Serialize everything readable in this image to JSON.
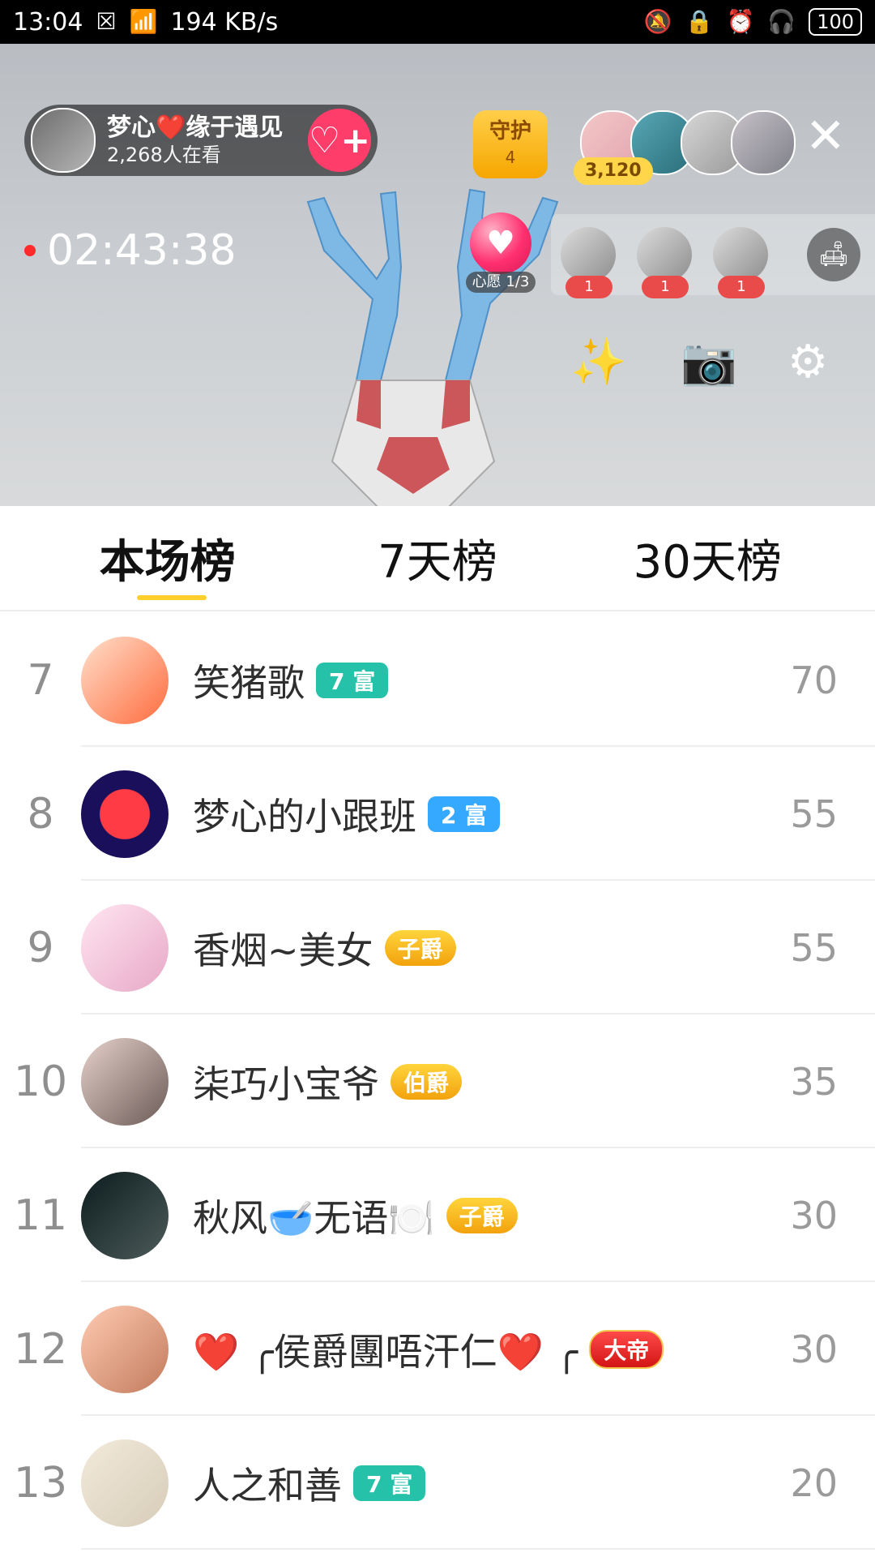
{
  "status_bar": {
    "time": "13:04",
    "network_speed": "194 KB/s",
    "battery": "100"
  },
  "live": {
    "host_name": "梦心❤️缘于遇见",
    "viewers": "2,268人在看",
    "follow_button": "♡+",
    "guard_label": "守护",
    "guard_count": "4",
    "contribution": "3,120",
    "timer": "02:43:38",
    "wish_label": "心愿 1/3",
    "mic_counts": [
      "1",
      "1",
      "1"
    ]
  },
  "tabs": [
    {
      "label": "本场榜"
    },
    {
      "label": "7天榜"
    },
    {
      "label": "30天榜"
    }
  ],
  "rank_rows": [
    {
      "rank": "7",
      "name": "笑猪歌",
      "badge": "7 富",
      "score": "70"
    },
    {
      "rank": "8",
      "name": "梦心的小跟班",
      "badge": "2 富",
      "score": "55"
    },
    {
      "rank": "9",
      "name": "香烟~美女",
      "badge": "子爵",
      "score": "55"
    },
    {
      "rank": "10",
      "name": "柒巧小宝爷",
      "badge": "伯爵",
      "score": "35"
    },
    {
      "rank": "11",
      "name": "秋风🥣无语🍽️",
      "badge": "子爵",
      "score": "30"
    },
    {
      "rank": "12",
      "name": "❤️ ╭侯爵團唔汗仁❤️ ╭",
      "badge": "大帝",
      "score": "30"
    },
    {
      "rank": "13",
      "name": "人之和善",
      "badge": "7 富",
      "score": "20"
    }
  ],
  "colors": {
    "tab_indicator": "#ffcf2e",
    "follow": "#ff3d6b",
    "badge_teal": "#25c1a8",
    "badge_blue": "#35a8ff"
  }
}
